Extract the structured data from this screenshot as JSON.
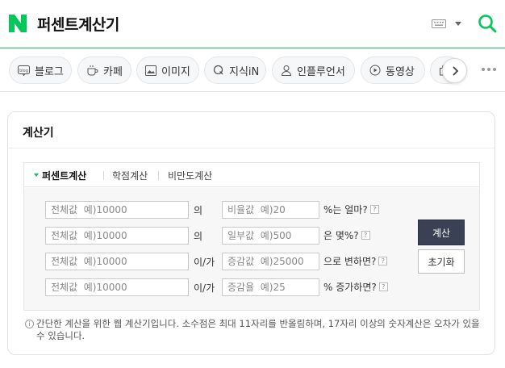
{
  "header": {
    "logo_letter": "N",
    "query": "퍼센트계산기",
    "brand_color": "#03c75a"
  },
  "tabs": [
    {
      "label": "블로그",
      "icon": "blog-icon"
    },
    {
      "label": "카페",
      "icon": "cafe-cup-icon"
    },
    {
      "label": "이미지",
      "icon": "image-icon"
    },
    {
      "label": "지식iN",
      "icon": "knowledge-q-icon"
    },
    {
      "label": "인플루언서",
      "icon": "person-icon"
    },
    {
      "label": "동영상",
      "icon": "play-circle-icon"
    },
    {
      "label": "",
      "icon": "shopping-bag-icon"
    }
  ],
  "card": {
    "title": "계산기",
    "subtabs": [
      "퍼센트계산",
      "학점계산",
      "비만도계산"
    ],
    "rows": [
      {
        "field1_placeholder": "전체값  예)10000",
        "connector": "의",
        "field2_placeholder": "비율값  예)20",
        "suffix": "%는 얼마?"
      },
      {
        "field1_placeholder": "전체값  예)10000",
        "connector": "의",
        "field2_placeholder": "일부값  예)500",
        "suffix": "은 몇%?"
      },
      {
        "field1_placeholder": "전체값  예)10000",
        "connector": "이/가",
        "field2_placeholder": "증감값  예)25000",
        "suffix": "으로 변하면?"
      },
      {
        "field1_placeholder": "전체값  예)10000",
        "connector": "이/가",
        "field2_placeholder": "증감율  예)25",
        "suffix": "% 증가하면?"
      }
    ],
    "help_mark": "?",
    "calc_button": "계산",
    "reset_button": "초기화",
    "notice": "간단한 계산을 위한 웹 계산기입니다. 소수점은 최대 11자리를 반올림하며, 17자리 이상의 숫자계산은 오차가 있을 수 있습니다.",
    "info_mark": "i"
  }
}
